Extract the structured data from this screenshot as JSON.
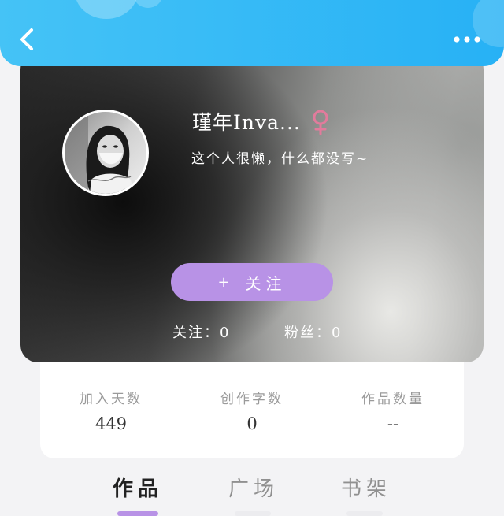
{
  "header": {
    "back_icon": "chevron-left-icon",
    "more_icon": "more-dots-icon",
    "accent_color": "#29b3f5"
  },
  "profile": {
    "nickname": "瑾年Inva...",
    "gender_icon": "female-symbol-icon",
    "gender_color": "#e27b9c",
    "bio": "这个人很懒，什么都没写~",
    "follow_button": {
      "plus": "+",
      "label": "关注",
      "color": "#b892e6"
    },
    "stats": {
      "following": "关注：0",
      "fans": "粉丝：0"
    }
  },
  "numbers": [
    {
      "label": "加入天数",
      "value": "449"
    },
    {
      "label": "创作字数",
      "value": "0"
    },
    {
      "label": "作品数量",
      "value": "--"
    }
  ],
  "tabs": [
    {
      "label": "作品",
      "active": true
    },
    {
      "label": "广场",
      "active": false
    },
    {
      "label": "书架",
      "active": false
    }
  ]
}
